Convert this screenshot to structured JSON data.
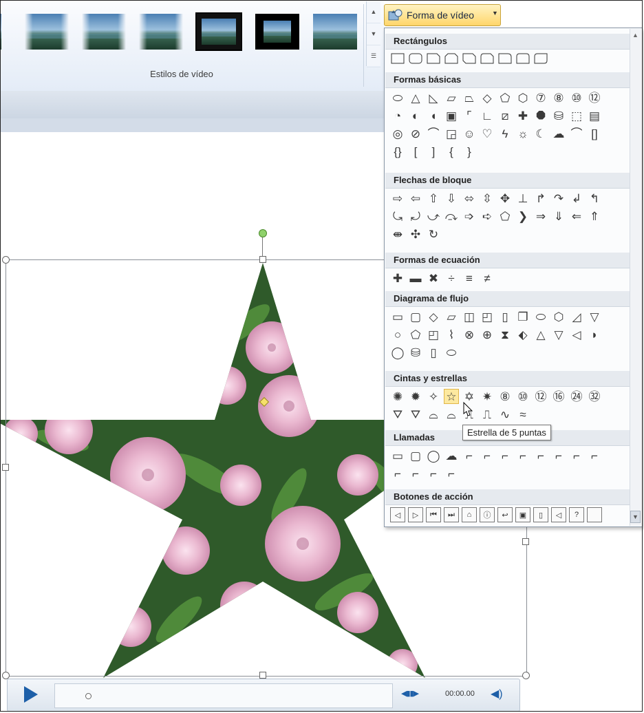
{
  "ribbon": {
    "group_label": "Estilos de vídeo",
    "style_count": 6
  },
  "shape_button": {
    "label": "Forma de vídeo",
    "icon": "video-shape-icon"
  },
  "panel": {
    "sections": [
      {
        "key": "rectangles",
        "label": "Rectángulos"
      },
      {
        "key": "basic",
        "label": "Formas básicas"
      },
      {
        "key": "arrows",
        "label": "Flechas de bloque"
      },
      {
        "key": "equation",
        "label": "Formas de ecuación"
      },
      {
        "key": "flowchart",
        "label": "Diagrama de flujo"
      },
      {
        "key": "stars",
        "label": "Cintas y estrellas"
      },
      {
        "key": "callouts",
        "label": "Llamadas"
      },
      {
        "key": "action",
        "label": "Botones de acción"
      }
    ],
    "highlighted_shape": "Estrella de 5 puntas"
  },
  "tooltip": {
    "text": "Estrella de 5 puntas"
  },
  "player": {
    "time": "00:00.00",
    "play_icon": "play-icon"
  },
  "colors": {
    "accent_button": "#ffd66b",
    "ribbon": "#e4ecf7",
    "play": "#1d5fa8"
  }
}
